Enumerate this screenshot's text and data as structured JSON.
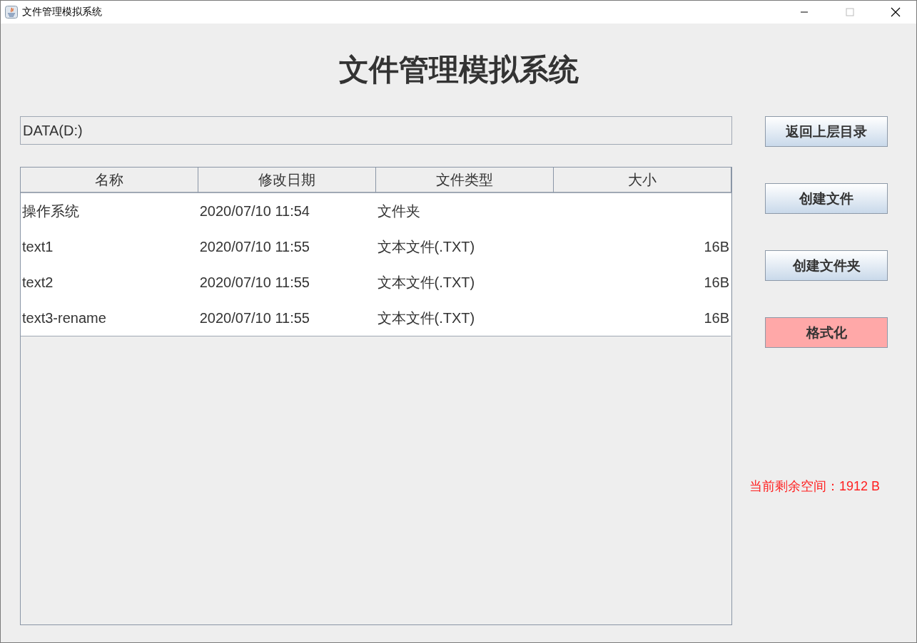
{
  "window": {
    "title": "文件管理模拟系统"
  },
  "heading": "文件管理模拟系统",
  "path_field": {
    "value": "DATA(D:)"
  },
  "table": {
    "columns": [
      "名称",
      "修改日期",
      "文件类型",
      "大小"
    ],
    "rows": [
      {
        "cells": [
          "操作系统",
          "2020/07/10 11:54",
          "文件夹",
          ""
        ]
      },
      {
        "cells": [
          "text1",
          "2020/07/10 11:55",
          "文本文件(.TXT)",
          "16B"
        ]
      },
      {
        "cells": [
          "text2",
          "2020/07/10 11:55",
          "文本文件(.TXT)",
          "16B"
        ]
      },
      {
        "cells": [
          "text3-rename",
          "2020/07/10 11:55",
          "文本文件(.TXT)",
          "16B"
        ]
      }
    ]
  },
  "buttons": [
    {
      "label": "返回上层目录",
      "kind": "normal"
    },
    {
      "label": "创建文件",
      "kind": "normal"
    },
    {
      "label": "创建文件夹",
      "kind": "normal"
    },
    {
      "label": "格式化",
      "kind": "danger"
    }
  ],
  "free_space": "当前剩余空间：1912 B"
}
